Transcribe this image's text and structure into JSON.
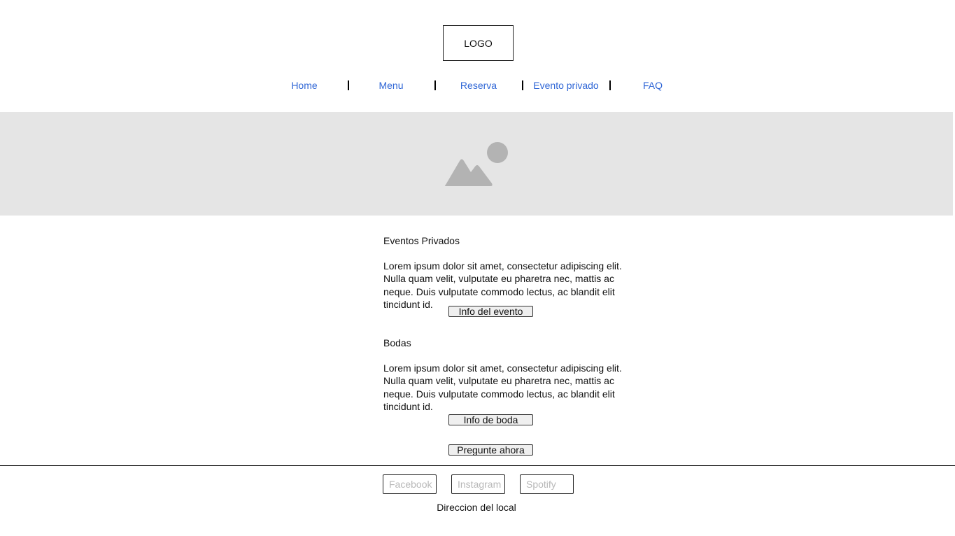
{
  "header": {
    "logo_text": "LOGO"
  },
  "nav": {
    "items": [
      {
        "label": "Home"
      },
      {
        "label": "Menu"
      },
      {
        "label": "Reserva"
      },
      {
        "label": "Evento privado"
      },
      {
        "label": "FAQ"
      }
    ],
    "link_color": "#2f66d6"
  },
  "hero": {
    "icon": "image-placeholder-icon",
    "background_color": "#e5e5e5"
  },
  "sections": [
    {
      "title": "Eventos Privados",
      "text": "Lorem ipsum dolor sit amet, consectetur adipiscing elit. Nulla quam velit, vulputate eu pharetra nec, mattis ac neque. Duis vulputate commodo lectus, ac blandit elit tincidunt id.",
      "button_label": "Info del evento"
    },
    {
      "title": "Bodas",
      "text": "Lorem ipsum dolor sit amet, consectetur adipiscing elit. Nulla quam velit, vulputate eu pharetra nec, mattis ac neque. Duis vulputate commodo lectus, ac blandit elit tincidunt id.",
      "button_label": "Info de boda"
    }
  ],
  "cta": {
    "button_label": "Pregunte ahora"
  },
  "footer": {
    "social": [
      {
        "label": "Facebook"
      },
      {
        "label": "Instagram"
      },
      {
        "label": "Spotify"
      }
    ],
    "address": "Direccion del local"
  }
}
